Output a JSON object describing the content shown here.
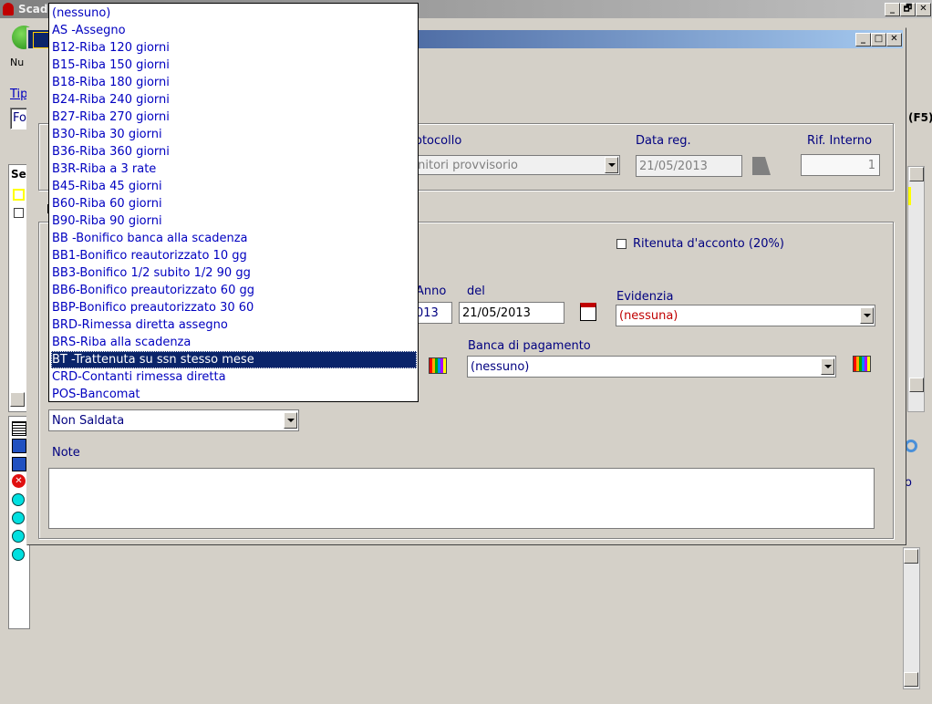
{
  "main_window": {
    "title": "Scade",
    "new_label": "Nu",
    "tipo_label": "Tip",
    "fo_value": "Fo",
    "f5_label": "(F5)",
    "se_label": "Se",
    "controls": {
      "min": "_",
      "restore": "🗗",
      "close": "✕"
    }
  },
  "dialog": {
    "controls": {
      "min": "_",
      "max": "□",
      "close": "✕"
    },
    "protocollo_label": "otocollo",
    "protocollo_value": "rnitori provvisorio",
    "data_reg_label": "Data reg.",
    "data_reg_value": "21/05/2013",
    "rif_interno_label": "Rif. Interno",
    "rif_interno_value": "1",
    "ritenuta_label": "Ritenuta d'acconto (20%)",
    "anno_label": "Anno",
    "anno_value": "013",
    "del_label": "del",
    "del_value": "21/05/2013",
    "evidenzia_label": "Evidenzia",
    "evidenzia_value": "(nessuna)",
    "banca_label": "Banca di pagamento",
    "banca_value": "(nessuno)",
    "stato_value": "Non Saldata",
    "note_label": "Note",
    "right_p": "o"
  },
  "payment_dropdown": {
    "selected_index": 20,
    "items": [
      "(nessuno)",
      "AS -Assegno",
      "B12-Riba 120 giorni",
      "B15-Riba 150 giorni",
      "B18-Riba 180 giorni",
      "B24-Riba 240 giorni",
      "B27-Riba 270 giorni",
      "B30-Riba 30 giorni",
      "B36-Riba 360 giorni",
      "B3R-Riba a 3 rate",
      "B45-Riba 45 giorni",
      "B60-Riba 60 giorni",
      "B90-Riba 90 giorni",
      "BB -Bonifico banca alla scadenza",
      "BB1-Bonifico reautorizzato 10 gg",
      "BB3-Bonifico 1/2 subito 1/2 90 gg",
      "BB6-Bonifico preautorizzato 60 gg",
      "BBP-Bonifico preautorizzato 30 60",
      "BRD-Rimessa diretta assegno",
      "BRS-Riba alla scadenza",
      "BT -Trattenuta su ssn stesso mese",
      "CRD-Contanti rimessa diretta",
      "POS-Bancomat"
    ]
  },
  "colors": {
    "selection": "#0a246a",
    "item_text": "#0000c0",
    "label_text": "#000080",
    "evidenzia_text": "#c00000"
  }
}
